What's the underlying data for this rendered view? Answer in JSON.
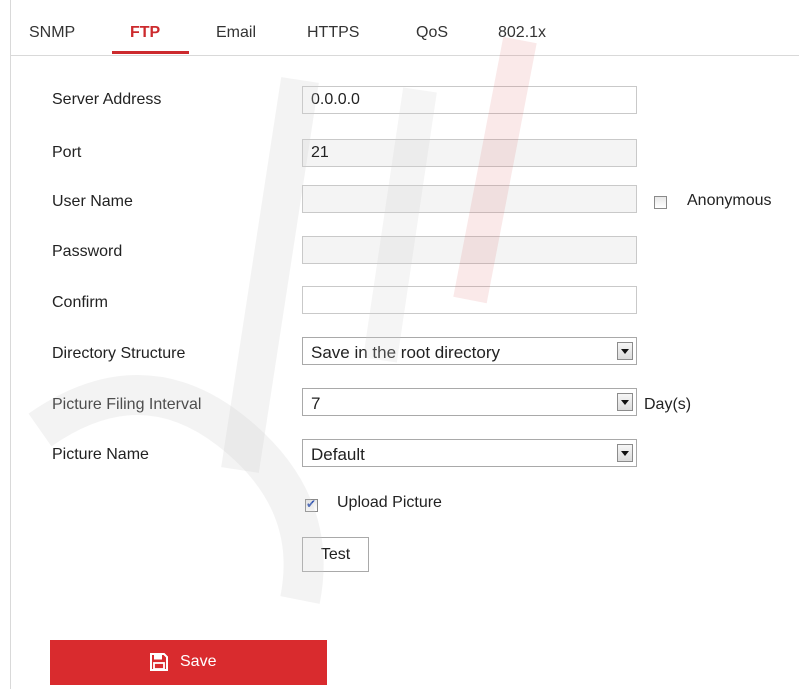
{
  "tabs": [
    {
      "label": "SNMP",
      "active": false
    },
    {
      "label": "FTP",
      "active": true
    },
    {
      "label": "Email",
      "active": false
    },
    {
      "label": "HTTPS",
      "active": false
    },
    {
      "label": "QoS",
      "active": false
    },
    {
      "label": "802.1x",
      "active": false
    }
  ],
  "form": {
    "server_address": {
      "label": "Server Address",
      "value": "0.0.0.0"
    },
    "port": {
      "label": "Port",
      "value": "21"
    },
    "user_name": {
      "label": "User Name",
      "value": ""
    },
    "anonymous": {
      "label": "Anonymous",
      "checked": false
    },
    "password": {
      "label": "Password",
      "value": ""
    },
    "confirm": {
      "label": "Confirm",
      "value": ""
    },
    "directory_structure": {
      "label": "Directory Structure",
      "value": "Save in the root directory"
    },
    "picture_filing_interval": {
      "label": "Picture Filing Interval",
      "value": "7",
      "unit": "Day(s)"
    },
    "picture_name": {
      "label": "Picture Name",
      "value": "Default"
    },
    "upload_picture": {
      "label": "Upload Picture",
      "checked": true
    }
  },
  "buttons": {
    "test": "Test",
    "save": "Save"
  },
  "colors": {
    "accent": "#cc2a2d",
    "save_button": "#d92b2e"
  },
  "icons": {
    "save": "floppy-disk-icon",
    "dropdown": "chevron-down-icon"
  }
}
